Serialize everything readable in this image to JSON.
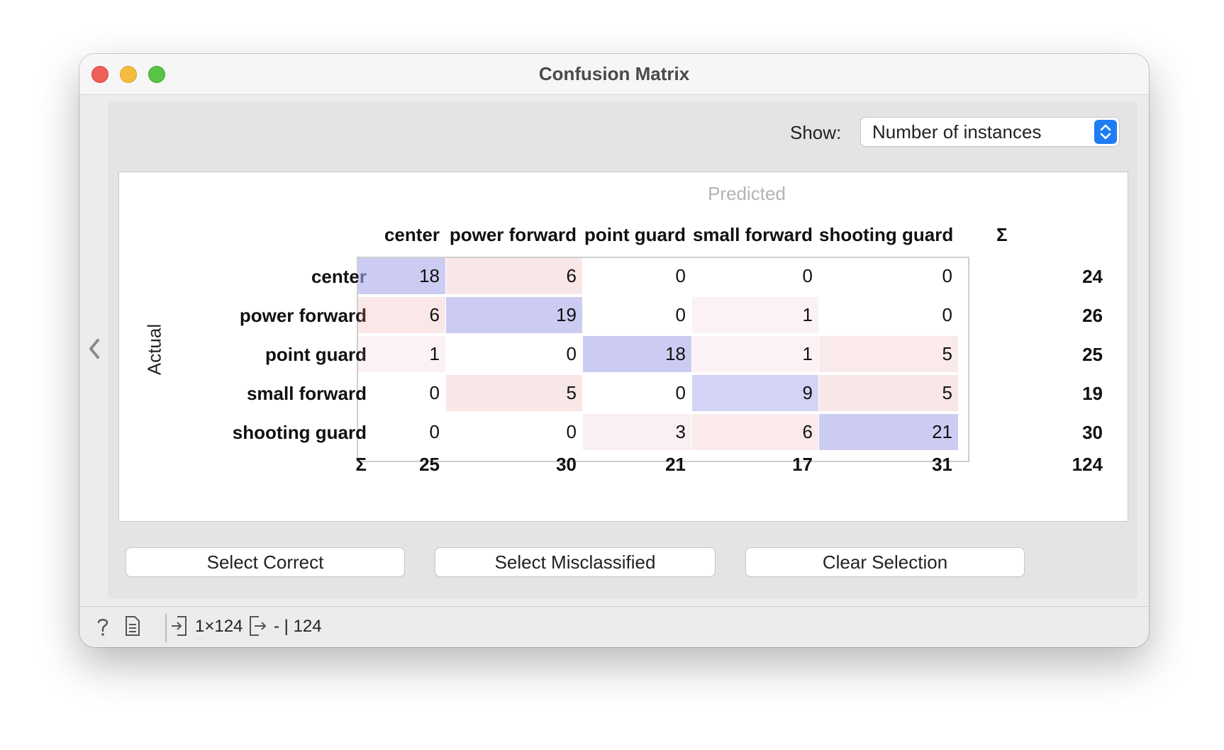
{
  "window": {
    "title": "Confusion Matrix"
  },
  "controls": {
    "show_label": "Show:",
    "show_value": "Number of instances"
  },
  "matrix": {
    "predicted_label": "Predicted",
    "actual_label": "Actual",
    "sum_symbol": "Σ",
    "classes": [
      "center",
      "power forward",
      "point guard",
      "small forward",
      "shooting guard"
    ],
    "rows": [
      {
        "label": "center",
        "values": [
          "18",
          "6",
          "0",
          "0",
          "0"
        ],
        "sum": "24"
      },
      {
        "label": "power forward",
        "values": [
          "6",
          "19",
          "0",
          "1",
          "0"
        ],
        "sum": "26"
      },
      {
        "label": "point guard",
        "values": [
          "1",
          "0",
          "18",
          "1",
          "5"
        ],
        "sum": "25"
      },
      {
        "label": "small forward",
        "values": [
          "0",
          "5",
          "0",
          "9",
          "5"
        ],
        "sum": "19"
      },
      {
        "label": "shooting guard",
        "values": [
          "0",
          "0",
          "3",
          "6",
          "21"
        ],
        "sum": "30"
      }
    ],
    "column_sums": [
      "25",
      "30",
      "21",
      "17",
      "31"
    ],
    "total": "124",
    "colors": {
      "correct": "#cfcff4",
      "misclassified": "#f2cfd1"
    }
  },
  "buttons": {
    "select_correct": "Select Correct",
    "select_misclassified": "Select Misclassified",
    "clear_selection": "Clear Selection"
  },
  "status": {
    "input_summary": "1×124",
    "output_summary": "- | 124"
  },
  "icons": [
    "collapse-arrow-icon",
    "help-icon",
    "report-icon",
    "input-icon",
    "output-icon",
    "stepper-icon"
  ]
}
